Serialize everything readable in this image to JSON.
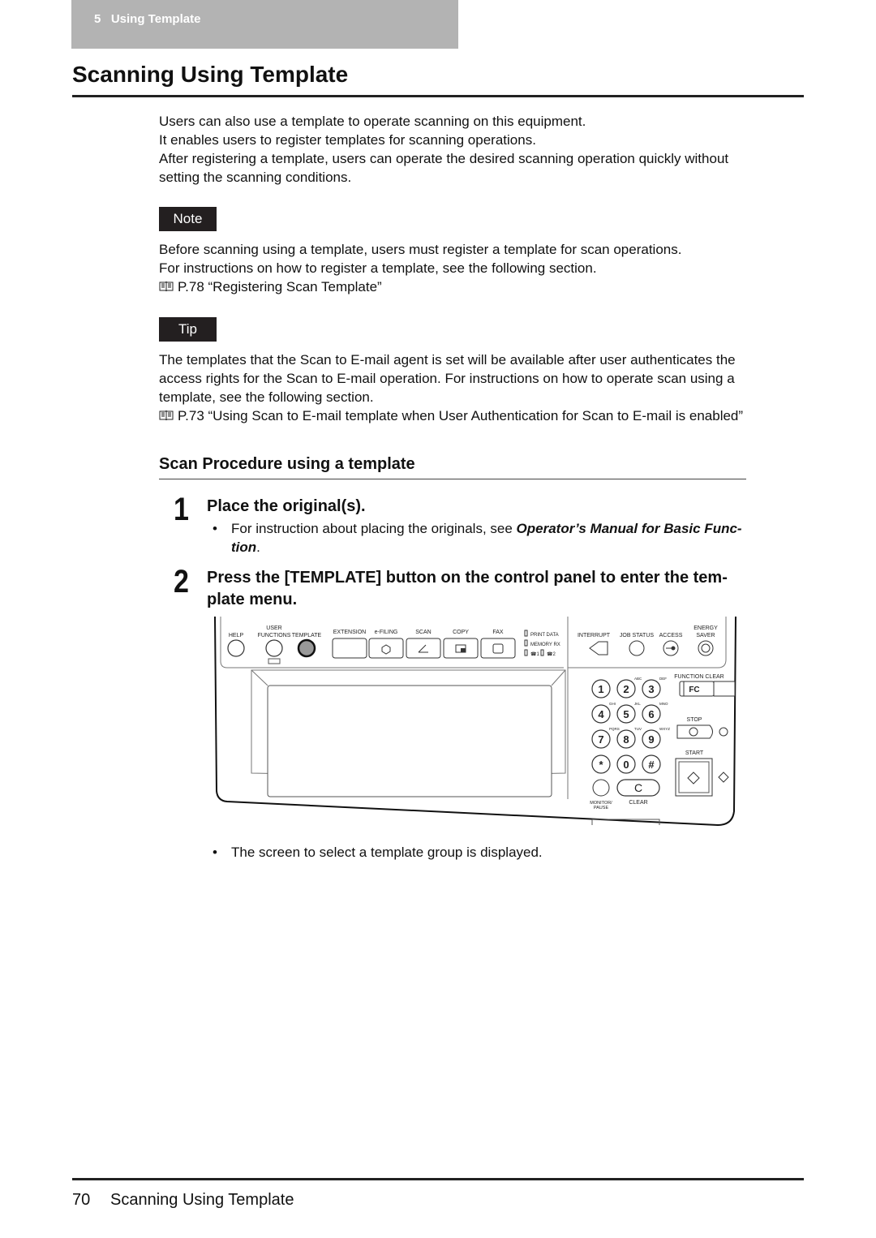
{
  "header": {
    "chapter_tab": "5   Using Template"
  },
  "page_title": "Scanning Using Template",
  "intro": [
    "Users can also use a template to operate scanning on this equipment.",
    "It enables users to register templates for scanning operations.",
    "After registering a template, users can operate the desired scanning operation quickly without",
    "setting the scanning conditions."
  ],
  "note": {
    "label": "Note",
    "lines": [
      "Before scanning using a template, users must register a template for scan operations.",
      "For instructions on how to register a template, see the following section."
    ],
    "reference": "P.78 “Registering Scan Template”"
  },
  "tip": {
    "label": "Tip",
    "lines": [
      "The templates that the Scan to E-mail agent is set will be available after user authenticates the",
      "access rights for the Scan to E-mail operation.  For instructions on how to operate scan using a",
      "template, see the following section."
    ],
    "reference": "P.73 “Using Scan to E-mail template when User Authentication for Scan to E-mail is enabled”"
  },
  "section": {
    "heading": "Scan Procedure using a template",
    "steps": [
      {
        "number": "1",
        "title": "Place the original(s).",
        "bullet_prefix": "For instruction about placing the originals, see ",
        "bullet_emphasis": "Operator’s Manual for Basic Func-",
        "bullet_emphasis_2": "tion",
        "bullet_suffix": "."
      },
      {
        "number": "2",
        "title_line1": "Press the [TEMPLATE] button on the control panel to enter the tem-",
        "title_line2": "plate menu.",
        "bullet": "The screen to select a template group is displayed."
      }
    ]
  },
  "control_panel": {
    "top_buttons": {
      "help": "HELP",
      "user_functions_1": "USER",
      "user_functions_2": "FUNCTIONS",
      "template": "TEMPLATE"
    },
    "mode_buttons": [
      "EXTENSION",
      "e-FILING",
      "SCAN",
      "COPY",
      "FAX"
    ],
    "indicators": [
      "PRINT DATA",
      "MEMORY RX",
      "☎1",
      "☎2"
    ],
    "right_buttons": {
      "interrupt": "INTERRUPT",
      "job_status": "JOB STATUS",
      "access": "ACCESS",
      "energy_saver_1": "ENERGY",
      "energy_saver_2": "SAVER"
    },
    "keypad": [
      {
        "key": "1",
        "sub": ""
      },
      {
        "key": "2",
        "sub": "ABC"
      },
      {
        "key": "3",
        "sub": "DEF"
      },
      {
        "key": "4",
        "sub": "GHI"
      },
      {
        "key": "5",
        "sub": "JKL"
      },
      {
        "key": "6",
        "sub": "MNO"
      },
      {
        "key": "7",
        "sub": "PQRS"
      },
      {
        "key": "8",
        "sub": "TUV"
      },
      {
        "key": "9",
        "sub": "WXYZ"
      },
      {
        "key": "*",
        "sub": ""
      },
      {
        "key": "0",
        "sub": ""
      },
      {
        "key": "#",
        "sub": ""
      }
    ],
    "function_clear_label": "FUNCTION CLEAR",
    "fc_key": "FC",
    "stop_label": "STOP",
    "start_label": "START",
    "monitor_pause_1": "MONITOR/",
    "monitor_pause_2": "PAUSE",
    "clear_key": "C",
    "clear_label": "CLEAR"
  },
  "footer": {
    "page_number": "70",
    "title": "Scanning Using Template"
  }
}
